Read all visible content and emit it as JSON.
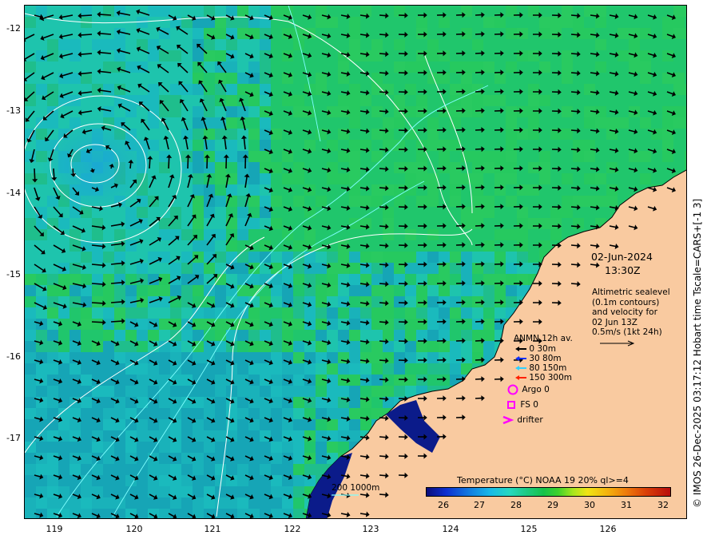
{
  "map": {
    "lat_labels": [
      "-12",
      "-13",
      "-14",
      "-15",
      "-16",
      "-17"
    ],
    "lon_labels": [
      "119",
      "120",
      "121",
      "122",
      "123",
      "124",
      "125",
      "126"
    ],
    "credit": "© IMOS 26-Dec-2025 03:17:12 Hobart time Tscale=CARS+[-1 3]",
    "date": "02-Jun-2024",
    "time": "13:30Z",
    "altimetry_info": [
      "Altimetric sealevel",
      "(0.1m contours)",
      "and velocity for",
      "02 Jun 13Z",
      "0.5m/s (1kt 24h)"
    ],
    "depth_contour_label": "200  1000m",
    "colors": {
      "land": "#f9caa0",
      "ocean_cool": "#18b2e4",
      "ocean_warm": "#21cc52",
      "contour": "#ffffff",
      "isobath": "#7fffff"
    }
  },
  "legend": {
    "title": "ANMN 12h av.",
    "depth_items": [
      {
        "label": "0 30m",
        "color": "#000000"
      },
      {
        "label": "30 80m",
        "color": "#1030ff"
      },
      {
        "label": "80 150m",
        "color": "#30d0ff"
      },
      {
        "label": "150 300m",
        "color": "#ff2000"
      }
    ],
    "argo": "Argo 0",
    "fs": "FS 0",
    "drifter": "drifter",
    "marker_color": "#ff00ff"
  },
  "colorbar": {
    "title": "Temperature (°C) NOAA 19 20% ql>=4",
    "ticks": [
      "26",
      "27",
      "28",
      "29",
      "30",
      "31",
      "32"
    ],
    "range": [
      25.5,
      32.5
    ]
  }
}
